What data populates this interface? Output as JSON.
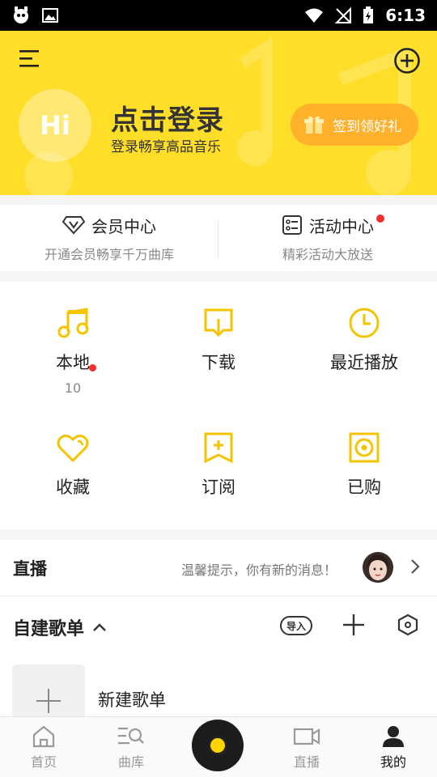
{
  "statusbar": {
    "time": "6:13"
  },
  "header": {
    "avatar_text": "Hi",
    "login_title": "点击登录",
    "login_subtitle": "登录畅享高品音乐",
    "signin_label": "签到领好礼"
  },
  "member": {
    "vip_title": "会员中心",
    "vip_sub": "开通会员畅享千万曲库",
    "activity_title": "活动中心",
    "activity_sub": "精彩活动大放送"
  },
  "grid": {
    "local": "本地",
    "local_count": "10",
    "download": "下载",
    "recent": "最近播放",
    "favorite": "收藏",
    "subscribe": "订阅",
    "purchased": "已购"
  },
  "live": {
    "title": "直播",
    "hint": "温馨提示，你有新的消息！"
  },
  "playlist": {
    "title": "自建歌单",
    "import_label": "导入",
    "new_label": "新建歌单"
  },
  "nav": {
    "home": "首页",
    "library": "曲库",
    "live": "直播",
    "mine": "我的"
  },
  "colors": {
    "accent": "#ffde2a",
    "signin": "#ffb12c",
    "badge": "#f0302c",
    "icon": "#f5c400"
  }
}
